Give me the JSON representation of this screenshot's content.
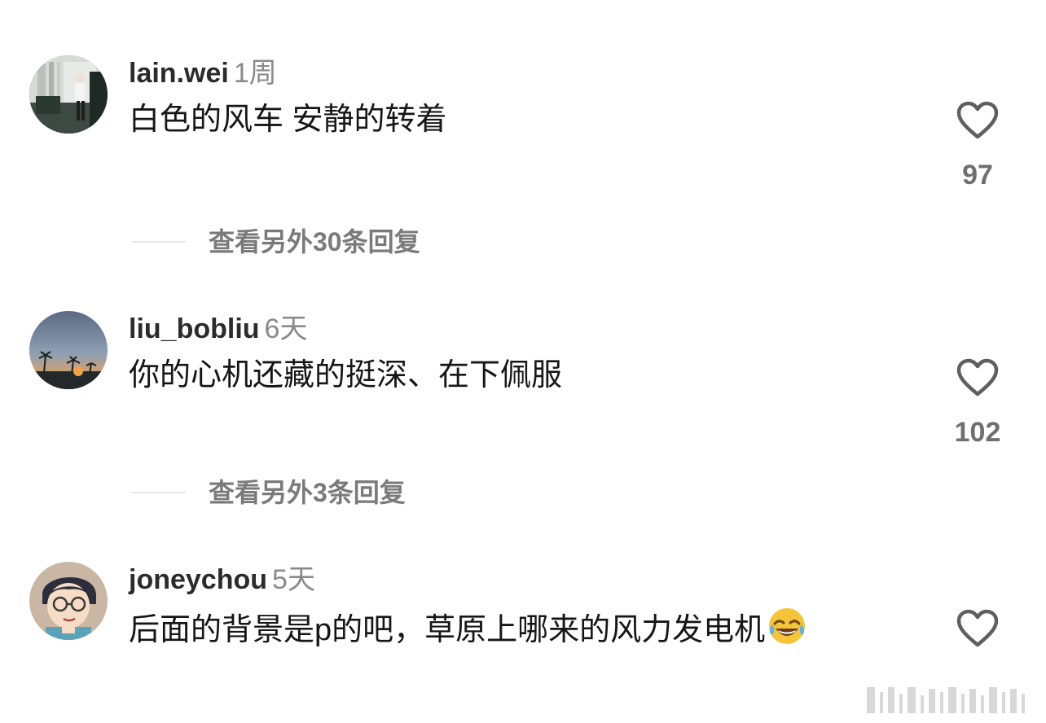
{
  "comments": [
    {
      "username": "lain.wei",
      "time": "1周",
      "text": "白色的风车 安静的转着",
      "likes": "97",
      "replies_label": "查看另外30条回复",
      "avatar_icon": "person-at-window-photo"
    },
    {
      "username": "liu_bobliu",
      "time": "6天",
      "text": "你的心机还藏的挺深、在下佩服",
      "likes": "102",
      "replies_label": "查看另外3条回复",
      "avatar_icon": "palm-sunset-photo"
    },
    {
      "username": "joneychou",
      "time": "5天",
      "text": "后面的背景是p的吧，草原上哪来的风力发电机",
      "emoji": "laughing-with-tears-emoji",
      "avatar_icon": "anime-boy-glasses-avatar"
    }
  ],
  "colors": {
    "username": "#2b2b2b",
    "time": "#8a8a8a",
    "text": "#161616",
    "like_icon": "#5f5f5f",
    "like_count": "#6f6f6f",
    "replies_label": "#7a7a7a",
    "divider": "#e6e6e6",
    "emoji_yellow": "#f6c438"
  },
  "icons": {
    "like": "heart-outline-icon"
  }
}
